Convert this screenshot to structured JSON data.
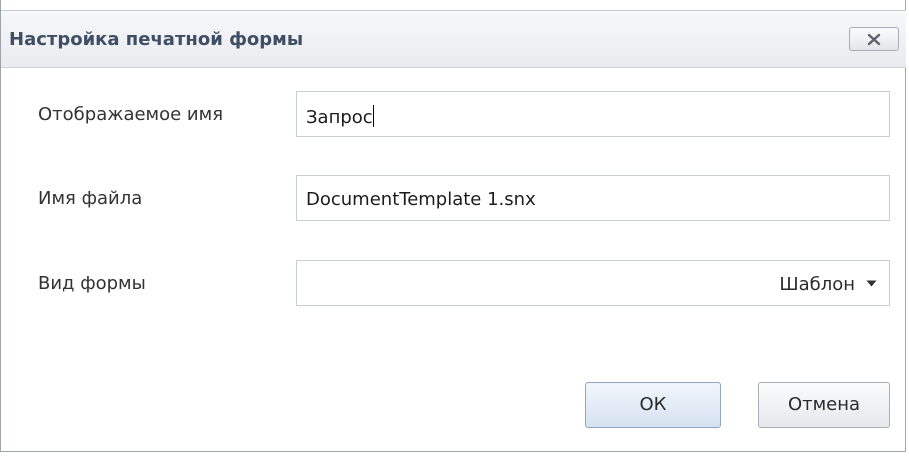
{
  "dialog": {
    "title": "Настройка печатной формы"
  },
  "fields": {
    "display_name": {
      "label": "Отображаемое имя",
      "value": "Запрос"
    },
    "file_name": {
      "label": "Имя файла",
      "value": "DocumentTemplate 1.snx"
    },
    "form_type": {
      "label": "Вид формы",
      "selected": "Шаблон"
    }
  },
  "buttons": {
    "ok": "ОК",
    "cancel": "Отмена"
  },
  "icons": {
    "close": "close-icon",
    "dropdown": "caret-down-icon"
  },
  "colors": {
    "title_text": "#3e4e64",
    "ok_button": "#d6e2f1",
    "field_border": "#c9ced4"
  }
}
